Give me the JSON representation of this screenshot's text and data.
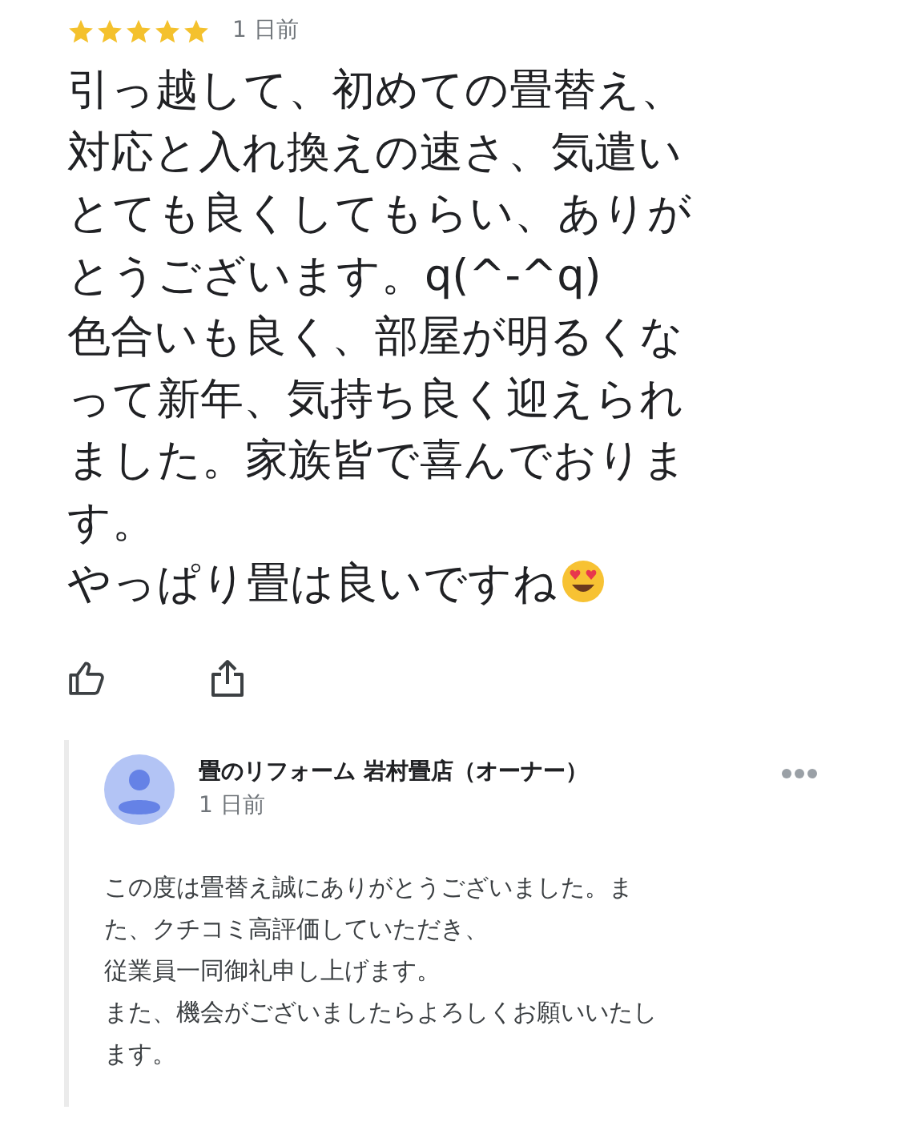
{
  "review": {
    "stars": 5,
    "time": "1 日前",
    "lines": [
      "引っ越して、初めての畳替え、",
      "対応と入れ換えの速さ、気遣い",
      "とても良くしてもらい、ありが",
      "とうございます。q(^-^q)",
      "色合いも良く、部屋が明るくな",
      "って新年、気持ち良く迎えられ",
      "ました。家族皆で喜んでおりま",
      "す。",
      "やっぱり畳は良いですね"
    ]
  },
  "reply": {
    "author": "畳のリフォーム 岩村畳店（オーナー）",
    "time": "1 日前",
    "lines": [
      "この度は畳替え誠にありがとうございました。ま",
      "た、クチコミ高評価していただき、",
      "従業員一同御礼申し上げます。",
      "また、機会がございましたらよろしくお願いいたし",
      "ます。"
    ]
  }
}
